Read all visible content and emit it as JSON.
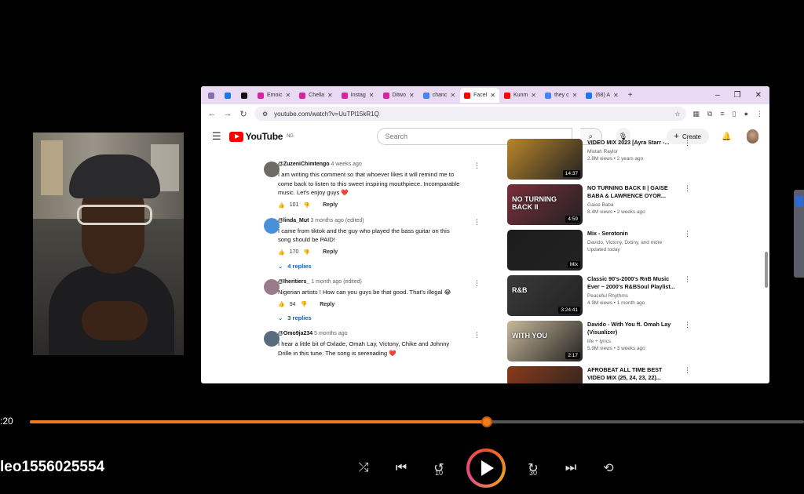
{
  "browser": {
    "tabs": [
      {
        "label": "",
        "icon": "tab-search-icon",
        "color": "#8a6bb3"
      },
      {
        "label": "",
        "icon": "meta-icon",
        "color": "#1877f2"
      },
      {
        "label": "",
        "icon": "threads-icon",
        "color": "#111111"
      },
      {
        "label": "Emoic",
        "icon": "instagram-icon",
        "color": "#d6249f"
      },
      {
        "label": "Chella",
        "icon": "instagram-icon",
        "color": "#d6249f"
      },
      {
        "label": "Instag",
        "icon": "instagram-icon",
        "color": "#d6249f"
      },
      {
        "label": "Ditwo",
        "icon": "instagram-icon",
        "color": "#d6249f"
      },
      {
        "label": "chanc",
        "icon": "google-icon",
        "color": "#4285f4"
      },
      {
        "label": "Facel",
        "icon": "youtube-icon",
        "color": "#ff0000",
        "active": true
      },
      {
        "label": "Kunm",
        "icon": "youtube-icon",
        "color": "#ff0000"
      },
      {
        "label": "they c",
        "icon": "google-icon",
        "color": "#4285f4"
      },
      {
        "label": "(68) A",
        "icon": "meta-icon",
        "color": "#1877f2"
      }
    ],
    "new_tab": "+",
    "url": "youtube.com/watch?v=UuTPl15kR1Q",
    "back": "←",
    "forward": "→",
    "reload": "↻"
  },
  "youtube": {
    "logo": "YouTube",
    "region": "NG",
    "search_placeholder": "Search",
    "create": "Create",
    "comments": [
      {
        "handle": "@ZuzeniChimtengo",
        "ago": "4 weeks ago",
        "text": "I am writing this comment so that whoever likes it will remind me to come back to listen to this sweet inspiring mouthpiece. Incomparable music. Let's enjoy guys ❤️",
        "likes": "101",
        "reply": "Reply",
        "avatar_color": "#6e6a66"
      },
      {
        "handle": "@linda_Mut",
        "ago": "3 months ago (edited)",
        "text": "I came from tiktok and the guy who played the bass guitar on this song should be PAID!",
        "likes": "170",
        "reply": "Reply",
        "replies": "4 replies",
        "avatar_color": "#4a90d9"
      },
      {
        "handle": "@Iheritiers_",
        "ago": "1 month ago (edited)",
        "text": "Nigerian artists ! How can you guys be that good. That's illegal 😂",
        "likes": "94",
        "reply": "Reply",
        "replies": "3 replies",
        "avatar_color": "#9a7b8c"
      },
      {
        "handle": "@Omo9ja234",
        "ago": "5 months ago",
        "text": "I hear a little bit of Oxlade, Omah Lay, Victony, Chike and Johnny Drille in this tune. The song is serenading ❤️",
        "avatar_color": "#5a6b7c"
      }
    ],
    "recommendations": [
      {
        "title": "VIDEO MIX 2023 [Ayra Starr -...",
        "channel": "Mixtah Raylor",
        "stats": "2.8M views • 2 years ago",
        "duration": "14:37",
        "thumb": "#b8862a"
      },
      {
        "title": "NO TURNING BACK II | GAISE BABA & LAWRENCE OYOR...",
        "channel": "Gaise Baba",
        "stats": "8.4M views • 2 weeks ago",
        "duration": "4:59",
        "thumb": "#7a2e3a",
        "thumb_text": "NO TURNING BACK II"
      },
      {
        "title": "Mix - Serotonin",
        "channel": "Davido, Victony, Dxtiny, and more",
        "stats": "Updated today",
        "duration": "Mix",
        "thumb": "#1c1c1c"
      },
      {
        "title": "Classic 90's-2000's RnB Music Ever ~ 2000's R&BSoul Playlist...",
        "channel": "Peaceful Rhythms",
        "stats": "4.9M views • 1 month ago",
        "duration": "3:24:41",
        "thumb": "#3a3a3a",
        "thumb_text": "R&B"
      },
      {
        "title": "Davido - With You ft. Omah Lay (Visualizer)",
        "channel": "life + lyrics",
        "stats": "5.9M views • 3 weeks ago",
        "duration": "2:17",
        "thumb": "#c8b89a",
        "thumb_text": "WITH YOU"
      },
      {
        "title": "AFROBEAT ALL TIME BEST VIDEO MIX (25, 24, 23, 22)...",
        "channel": "",
        "stats": "",
        "duration": "",
        "thumb": "#8a3a1a"
      }
    ]
  },
  "player": {
    "timecode": ":20",
    "progress": 0.59,
    "filename": "leo1556025554",
    "rewind_seconds": "10",
    "forward_seconds": "30"
  },
  "colors": {
    "accent": "#f07a1c",
    "tabbar": "#e9d9f3",
    "youtube_red": "#ff0000",
    "link_blue": "#065fd4"
  }
}
